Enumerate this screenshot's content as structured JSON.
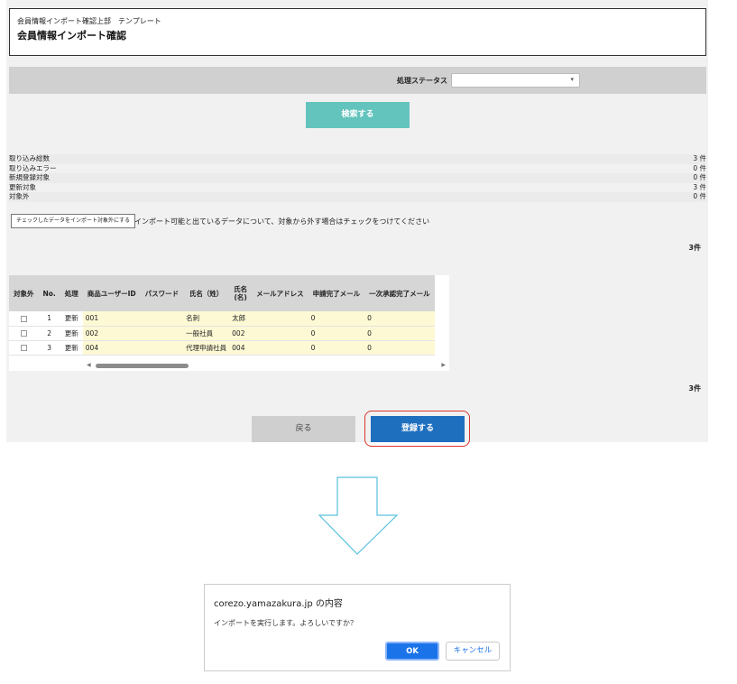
{
  "header": {
    "breadcrumb": "会員情報インポート確認上部　テンプレート",
    "title": "会員情報インポート確認"
  },
  "search": {
    "status_label": "処理ステータス",
    "status_value": "",
    "search_button": "検索する"
  },
  "summary": [
    {
      "label": "取り込み総数",
      "value": "3 件"
    },
    {
      "label": "取り込みエラー",
      "value": "0 件"
    },
    {
      "label": "新規登録対象",
      "value": "0 件"
    },
    {
      "label": "更新対象",
      "value": "3 件"
    },
    {
      "label": "対象外",
      "value": "0 件"
    }
  ],
  "exclude": {
    "button": "チェックしたデータをインポート対象外にする",
    "note": "インポート可能と出ているデータについて、対象から外す場合はチェックをつけてください"
  },
  "count_top": "3件",
  "count_bottom": "3件",
  "table": {
    "headers": [
      "対象外",
      "No.",
      "処理",
      "商品ユーザーID",
      "パスワード",
      "氏名（姓）",
      "氏名\n(名)",
      "メールアドレス",
      "申請完了メール",
      "一次承認完了メール"
    ],
    "rows": [
      {
        "no": "1",
        "action": "更新",
        "user_id": "001",
        "password": "",
        "last_name": "名刺",
        "first_name": "太郎",
        "email": "",
        "apply_mail": "0",
        "approve_mail": "0"
      },
      {
        "no": "2",
        "action": "更新",
        "user_id": "002",
        "password": "",
        "last_name": "一般社員",
        "first_name": "002",
        "email": "",
        "apply_mail": "0",
        "approve_mail": "0"
      },
      {
        "no": "3",
        "action": "更新",
        "user_id": "004",
        "password": "",
        "last_name": "代理申請社員",
        "first_name": "004",
        "email": "",
        "apply_mail": "0",
        "approve_mail": "0"
      }
    ]
  },
  "buttons": {
    "back": "戻る",
    "register": "登録する"
  },
  "dialog": {
    "title": "corezo.yamazakura.jp の内容",
    "message": "インポートを実行します。よろしいですか？",
    "ok": "OK",
    "cancel": "キャンセル"
  },
  "colors": {
    "search_button": "#63c3bd",
    "register_button": "#1f6fbf",
    "highlight_outline": "#d9342b",
    "arrow": "#5bc0de",
    "ok_button": "#1a73e8"
  }
}
